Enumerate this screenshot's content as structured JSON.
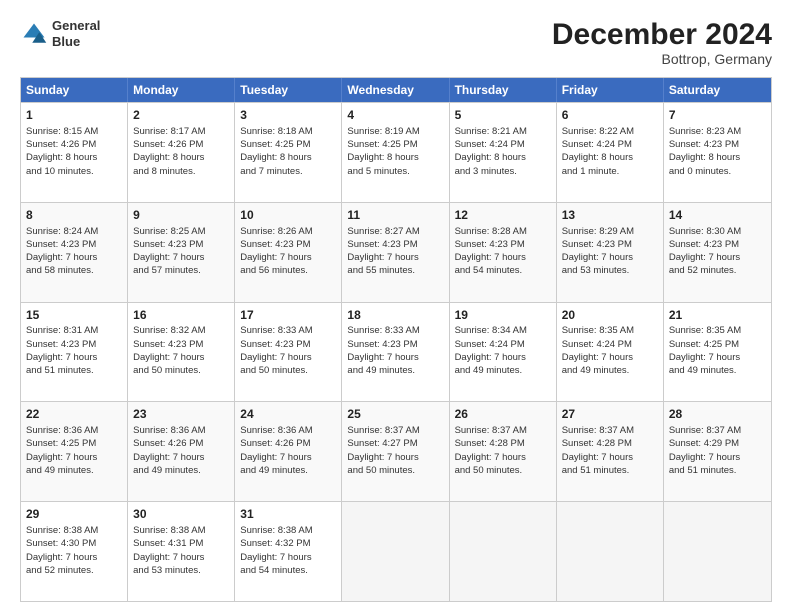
{
  "logo": {
    "line1": "General",
    "line2": "Blue"
  },
  "title": "December 2024",
  "subtitle": "Bottrop, Germany",
  "header_days": [
    "Sunday",
    "Monday",
    "Tuesday",
    "Wednesday",
    "Thursday",
    "Friday",
    "Saturday"
  ],
  "weeks": [
    [
      {
        "day": "1",
        "lines": [
          "Sunrise: 8:15 AM",
          "Sunset: 4:26 PM",
          "Daylight: 8 hours",
          "and 10 minutes."
        ]
      },
      {
        "day": "2",
        "lines": [
          "Sunrise: 8:17 AM",
          "Sunset: 4:26 PM",
          "Daylight: 8 hours",
          "and 8 minutes."
        ]
      },
      {
        "day": "3",
        "lines": [
          "Sunrise: 8:18 AM",
          "Sunset: 4:25 PM",
          "Daylight: 8 hours",
          "and 7 minutes."
        ]
      },
      {
        "day": "4",
        "lines": [
          "Sunrise: 8:19 AM",
          "Sunset: 4:25 PM",
          "Daylight: 8 hours",
          "and 5 minutes."
        ]
      },
      {
        "day": "5",
        "lines": [
          "Sunrise: 8:21 AM",
          "Sunset: 4:24 PM",
          "Daylight: 8 hours",
          "and 3 minutes."
        ]
      },
      {
        "day": "6",
        "lines": [
          "Sunrise: 8:22 AM",
          "Sunset: 4:24 PM",
          "Daylight: 8 hours",
          "and 1 minute."
        ]
      },
      {
        "day": "7",
        "lines": [
          "Sunrise: 8:23 AM",
          "Sunset: 4:23 PM",
          "Daylight: 8 hours",
          "and 0 minutes."
        ]
      }
    ],
    [
      {
        "day": "8",
        "lines": [
          "Sunrise: 8:24 AM",
          "Sunset: 4:23 PM",
          "Daylight: 7 hours",
          "and 58 minutes."
        ]
      },
      {
        "day": "9",
        "lines": [
          "Sunrise: 8:25 AM",
          "Sunset: 4:23 PM",
          "Daylight: 7 hours",
          "and 57 minutes."
        ]
      },
      {
        "day": "10",
        "lines": [
          "Sunrise: 8:26 AM",
          "Sunset: 4:23 PM",
          "Daylight: 7 hours",
          "and 56 minutes."
        ]
      },
      {
        "day": "11",
        "lines": [
          "Sunrise: 8:27 AM",
          "Sunset: 4:23 PM",
          "Daylight: 7 hours",
          "and 55 minutes."
        ]
      },
      {
        "day": "12",
        "lines": [
          "Sunrise: 8:28 AM",
          "Sunset: 4:23 PM",
          "Daylight: 7 hours",
          "and 54 minutes."
        ]
      },
      {
        "day": "13",
        "lines": [
          "Sunrise: 8:29 AM",
          "Sunset: 4:23 PM",
          "Daylight: 7 hours",
          "and 53 minutes."
        ]
      },
      {
        "day": "14",
        "lines": [
          "Sunrise: 8:30 AM",
          "Sunset: 4:23 PM",
          "Daylight: 7 hours",
          "and 52 minutes."
        ]
      }
    ],
    [
      {
        "day": "15",
        "lines": [
          "Sunrise: 8:31 AM",
          "Sunset: 4:23 PM",
          "Daylight: 7 hours",
          "and 51 minutes."
        ]
      },
      {
        "day": "16",
        "lines": [
          "Sunrise: 8:32 AM",
          "Sunset: 4:23 PM",
          "Daylight: 7 hours",
          "and 50 minutes."
        ]
      },
      {
        "day": "17",
        "lines": [
          "Sunrise: 8:33 AM",
          "Sunset: 4:23 PM",
          "Daylight: 7 hours",
          "and 50 minutes."
        ]
      },
      {
        "day": "18",
        "lines": [
          "Sunrise: 8:33 AM",
          "Sunset: 4:23 PM",
          "Daylight: 7 hours",
          "and 49 minutes."
        ]
      },
      {
        "day": "19",
        "lines": [
          "Sunrise: 8:34 AM",
          "Sunset: 4:24 PM",
          "Daylight: 7 hours",
          "and 49 minutes."
        ]
      },
      {
        "day": "20",
        "lines": [
          "Sunrise: 8:35 AM",
          "Sunset: 4:24 PM",
          "Daylight: 7 hours",
          "and 49 minutes."
        ]
      },
      {
        "day": "21",
        "lines": [
          "Sunrise: 8:35 AM",
          "Sunset: 4:25 PM",
          "Daylight: 7 hours",
          "and 49 minutes."
        ]
      }
    ],
    [
      {
        "day": "22",
        "lines": [
          "Sunrise: 8:36 AM",
          "Sunset: 4:25 PM",
          "Daylight: 7 hours",
          "and 49 minutes."
        ]
      },
      {
        "day": "23",
        "lines": [
          "Sunrise: 8:36 AM",
          "Sunset: 4:26 PM",
          "Daylight: 7 hours",
          "and 49 minutes."
        ]
      },
      {
        "day": "24",
        "lines": [
          "Sunrise: 8:36 AM",
          "Sunset: 4:26 PM",
          "Daylight: 7 hours",
          "and 49 minutes."
        ]
      },
      {
        "day": "25",
        "lines": [
          "Sunrise: 8:37 AM",
          "Sunset: 4:27 PM",
          "Daylight: 7 hours",
          "and 50 minutes."
        ]
      },
      {
        "day": "26",
        "lines": [
          "Sunrise: 8:37 AM",
          "Sunset: 4:28 PM",
          "Daylight: 7 hours",
          "and 50 minutes."
        ]
      },
      {
        "day": "27",
        "lines": [
          "Sunrise: 8:37 AM",
          "Sunset: 4:28 PM",
          "Daylight: 7 hours",
          "and 51 minutes."
        ]
      },
      {
        "day": "28",
        "lines": [
          "Sunrise: 8:37 AM",
          "Sunset: 4:29 PM",
          "Daylight: 7 hours",
          "and 51 minutes."
        ]
      }
    ],
    [
      {
        "day": "29",
        "lines": [
          "Sunrise: 8:38 AM",
          "Sunset: 4:30 PM",
          "Daylight: 7 hours",
          "and 52 minutes."
        ]
      },
      {
        "day": "30",
        "lines": [
          "Sunrise: 8:38 AM",
          "Sunset: 4:31 PM",
          "Daylight: 7 hours",
          "and 53 minutes."
        ]
      },
      {
        "day": "31",
        "lines": [
          "Sunrise: 8:38 AM",
          "Sunset: 4:32 PM",
          "Daylight: 7 hours",
          "and 54 minutes."
        ]
      },
      {
        "day": "",
        "lines": []
      },
      {
        "day": "",
        "lines": []
      },
      {
        "day": "",
        "lines": []
      },
      {
        "day": "",
        "lines": []
      }
    ]
  ]
}
